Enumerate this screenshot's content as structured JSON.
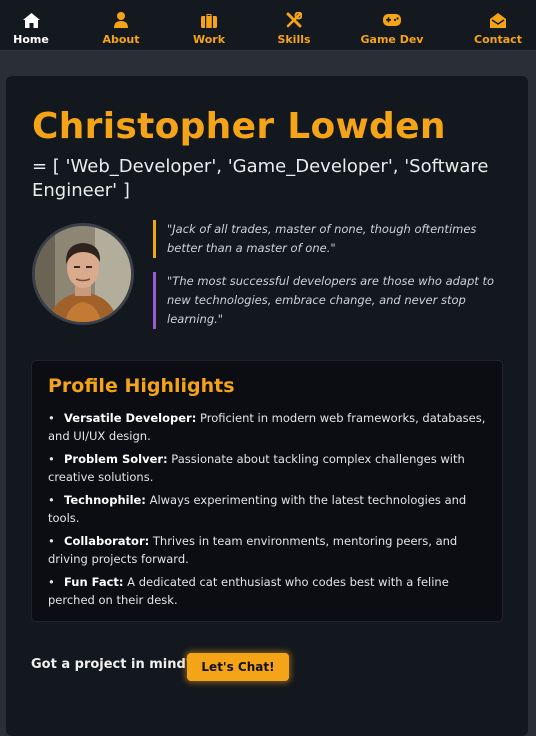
{
  "nav": {
    "items": [
      {
        "label": "Home",
        "icon": "home-icon"
      },
      {
        "label": "About",
        "icon": "user-icon"
      },
      {
        "label": "Work",
        "icon": "briefcase-icon"
      },
      {
        "label": "Skills",
        "icon": "tools-icon"
      },
      {
        "label": "Game Dev",
        "icon": "gamepad-icon"
      },
      {
        "label": "Contact",
        "icon": "envelope-icon"
      }
    ],
    "active": "Home"
  },
  "hero": {
    "name": "Christopher Lowden",
    "roles": "= [ 'Web_Developer', 'Game_Developer', 'Software Engineer' ]",
    "quotes": [
      "\"Jack of all trades, master of none, though oftentimes better than a master of one.\"",
      "\"The most successful developers are those who adapt to new technologies, embrace change, and never stop learning.\""
    ]
  },
  "highlights": {
    "title": "Profile Highlights",
    "items": [
      {
        "term": "Versatile Developer:",
        "text": " Proficient in modern web frameworks, databases, and UI/UX design."
      },
      {
        "term": "Problem Solver:",
        "text": " Passionate about tackling complex challenges with creative solutions."
      },
      {
        "term": "Technophile:",
        "text": " Always experimenting with the latest technologies and tools."
      },
      {
        "term": "Collaborator:",
        "text": " Thrives in team environments, mentoring peers, and driving projects forward."
      },
      {
        "term": "Fun Fact:",
        "text": " A dedicated cat enthusiast who codes best with a feline perched on their desk."
      }
    ]
  },
  "cta": {
    "text": "Got a project in mind?",
    "button": "Let's Chat!"
  },
  "colors": {
    "accent": "#f5a418",
    "quote_border_2": "#9b59d6",
    "background": "#2a2f37",
    "card": "#13171e"
  }
}
